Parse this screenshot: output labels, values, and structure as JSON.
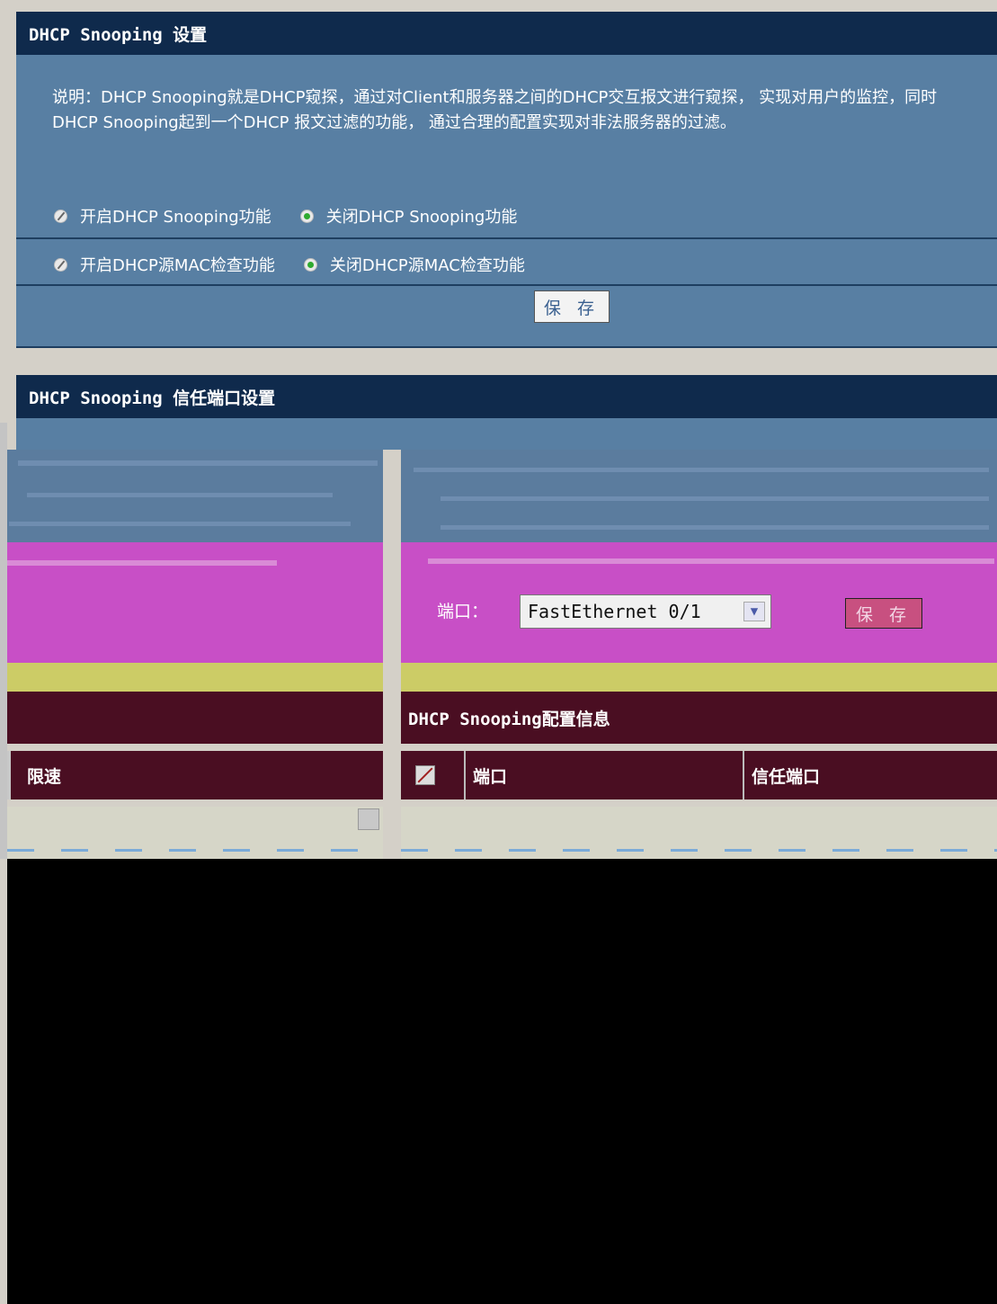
{
  "snooping_settings": {
    "title": "DHCP Snooping 设置",
    "description": "说明：DHCP Snooping就是DHCP窥探，通过对Client和服务器之间的DHCP交互报文进行窥探， 实现对用户的监控，同时DHCP Snooping起到一个DHCP 报文过滤的功能， 通过合理的配置实现对非法服务器的过滤。",
    "snooping_on": "开启DHCP Snooping功能",
    "snooping_off": "关闭DHCP Snooping功能",
    "mac_check_on": "开启DHCP源MAC检查功能",
    "mac_check_off": "关闭DHCP源MAC检查功能",
    "save_label": "保 存"
  },
  "trust_port_settings": {
    "title": "DHCP Snooping 信任端口设置",
    "port_label": "端口：",
    "port_value": "FastEthernet 0/1",
    "save_label": "保 存"
  },
  "config_info": {
    "title": "DHCP Snooping配置信息",
    "columns": [
      "端口",
      "信任端口"
    ]
  },
  "left_table": {
    "column": "限速"
  },
  "colors": {
    "header_bg": "#0f2a4c",
    "panel_bg": "#587fa3",
    "magenta": "#c84fc6",
    "maroon": "#4a0e22"
  }
}
